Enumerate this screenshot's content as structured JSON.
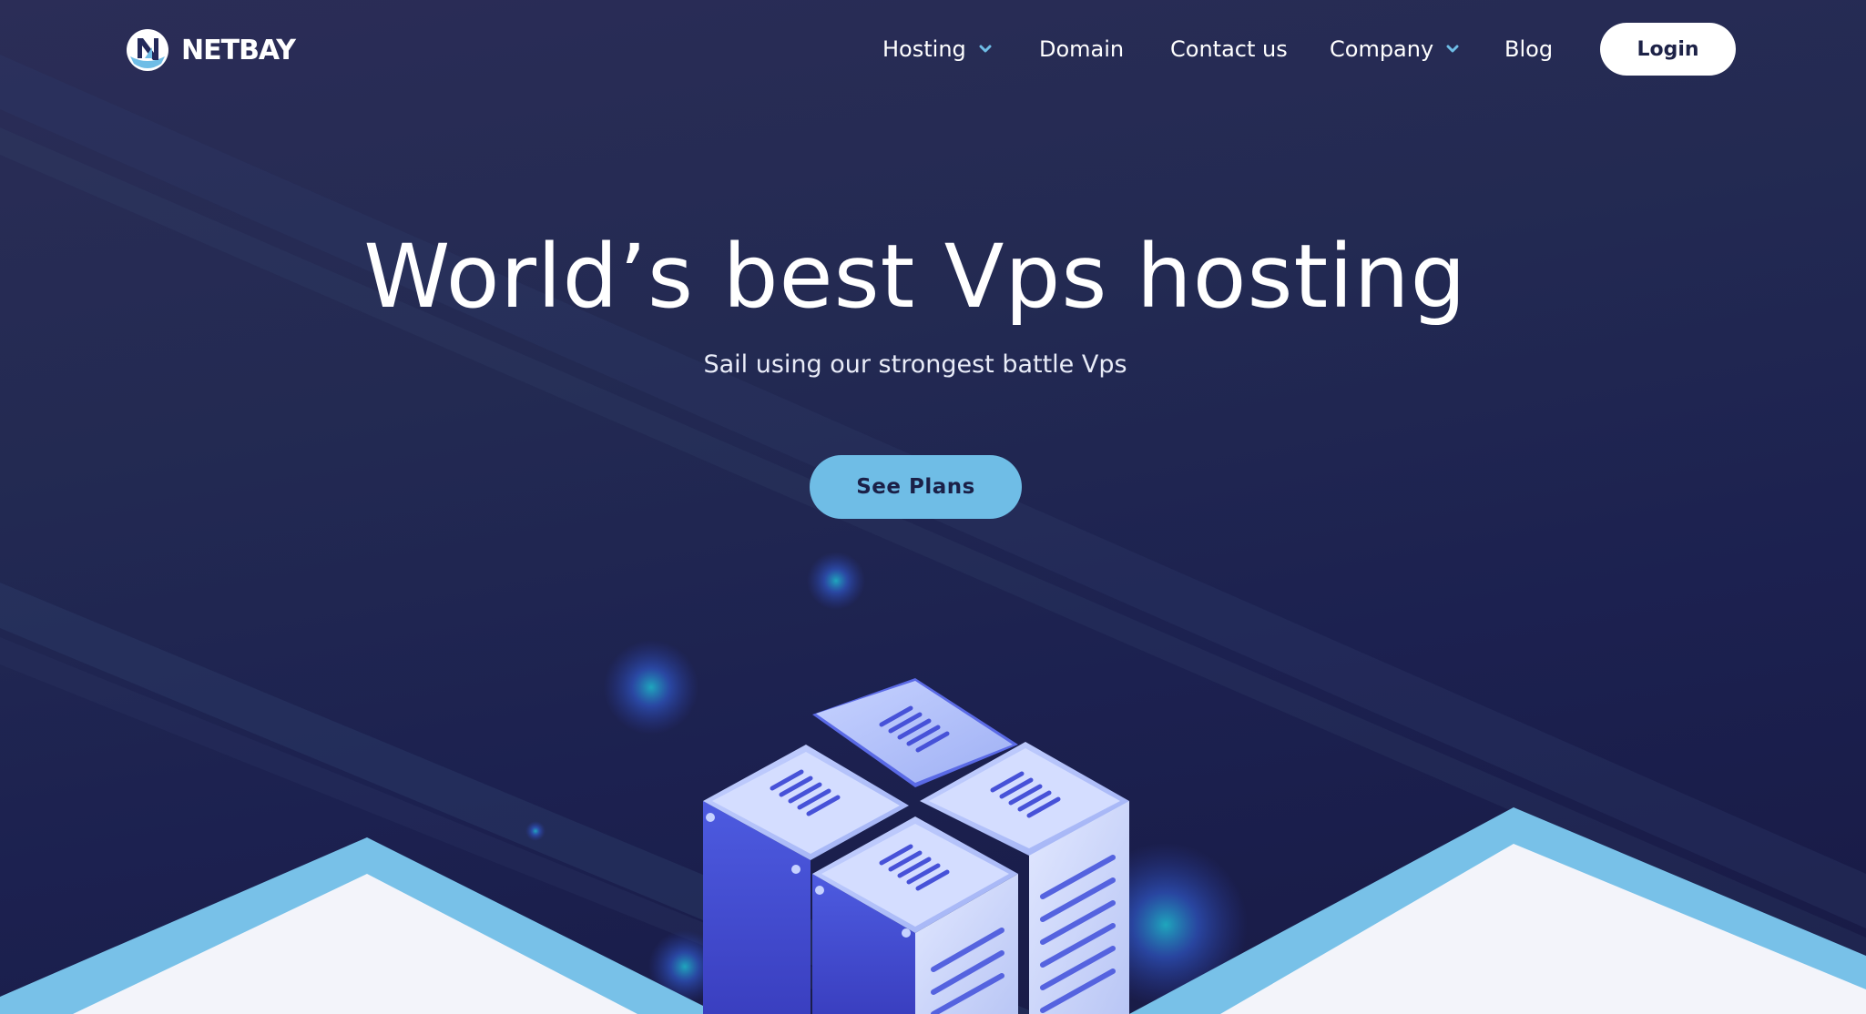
{
  "brand": {
    "name": "NETBAY",
    "logo_icon": "sailboat-n-logo"
  },
  "nav": {
    "items": [
      {
        "label": "Hosting",
        "has_dropdown": true
      },
      {
        "label": "Domain",
        "has_dropdown": false
      },
      {
        "label": "Contact us",
        "has_dropdown": false
      },
      {
        "label": "Company",
        "has_dropdown": true
      },
      {
        "label": "Blog",
        "has_dropdown": false
      }
    ],
    "login_label": "Login"
  },
  "hero": {
    "title": "World’s best Vps hosting",
    "subtitle": "Sail using our strongest battle Vps",
    "cta_label": "See Plans",
    "illustration": "server-rack-illustration"
  },
  "colors": {
    "background": "#232a52",
    "accent": "#6fbde6",
    "chevron": "#6fbde6",
    "server_blue": "#4a55d6",
    "light_panel": "#f3f4fa"
  }
}
